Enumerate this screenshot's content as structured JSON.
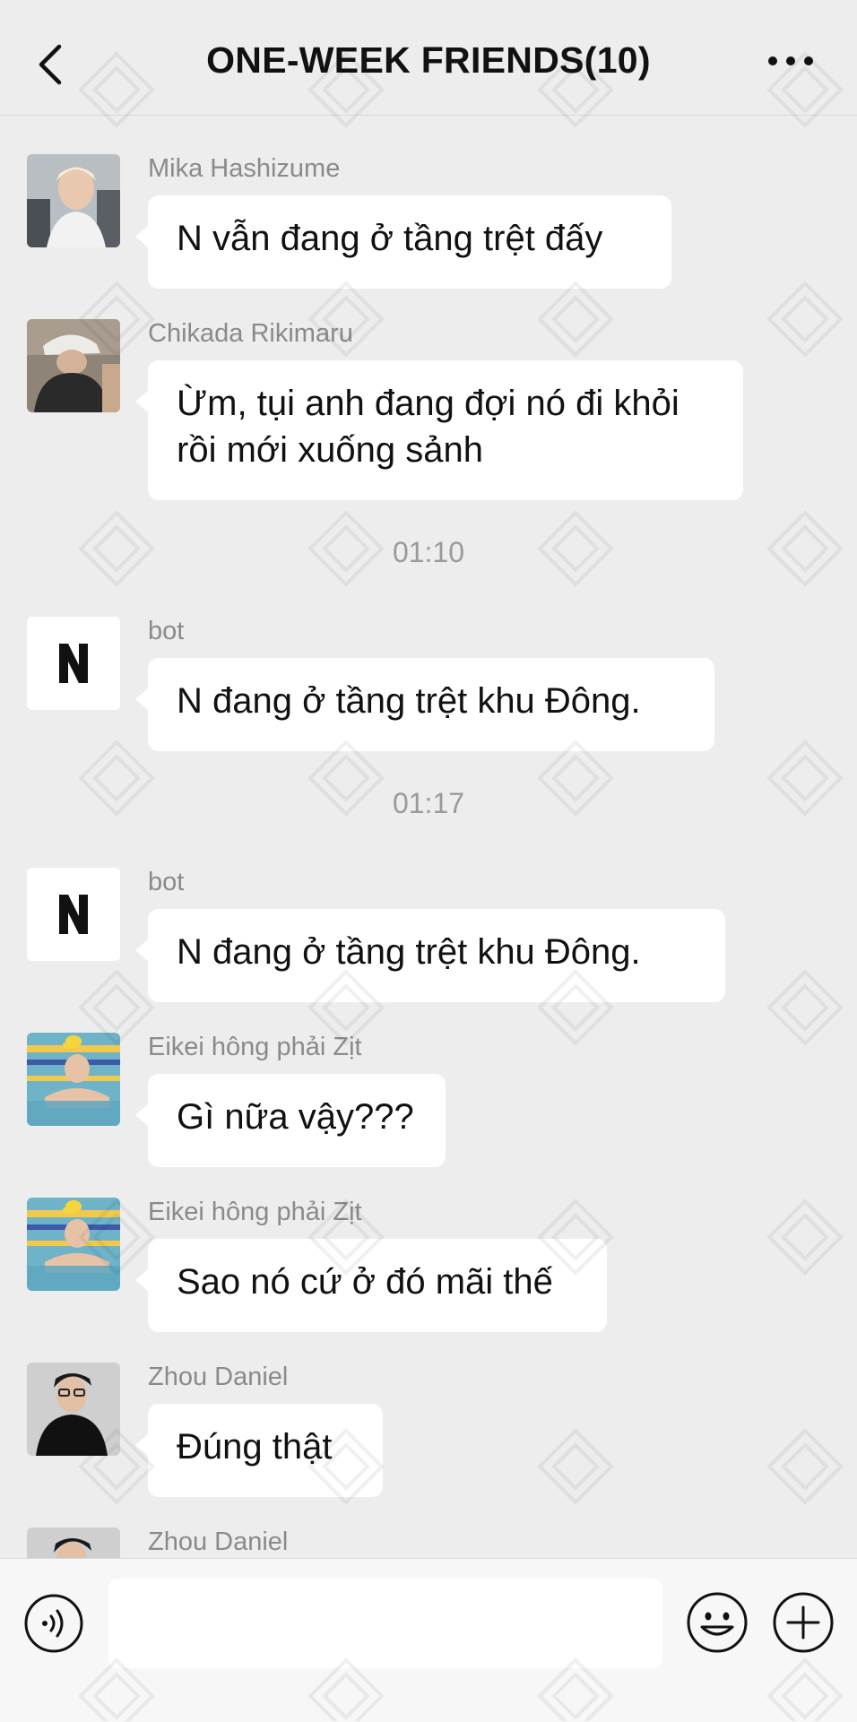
{
  "header": {
    "title": "ONE-WEEK FRIENDS(10)",
    "back_icon": "chevron-left-icon",
    "more_icon": "ellipsis-icon"
  },
  "messages": [
    {
      "sender": "Mika Hashizume",
      "text": "N vẫn đang ở tầng trệt đấy"
    },
    {
      "sender": "Chikada Rikimaru",
      "text": "Ừm, tụi anh đang đợi nó đi khỏi rồi mới xuống sảnh"
    },
    {
      "time": "01:10"
    },
    {
      "sender": "bot",
      "text": "N đang ở tầng trệt khu Đông."
    },
    {
      "time": "01:17"
    },
    {
      "sender": "bot",
      "text": "N đang ở tầng trệt khu Đông."
    },
    {
      "sender": "Eikei hông phải Zịt",
      "text": "Gì nữa vậy???"
    },
    {
      "sender": "Eikei hông phải Zịt",
      "text": "Sao nó cứ ở đó mãi thế"
    },
    {
      "sender": "Zhou Daniel",
      "text": "Đúng thật"
    },
    {
      "sender": "Zhou Daniel"
    }
  ],
  "input_bar": {
    "voice_icon": "voice-icon",
    "message_value": "",
    "emoji_icon": "smiley-icon",
    "plus_icon": "plus-icon"
  },
  "colors": {
    "background": "#EDEDED",
    "bubble": "#FFFFFF",
    "sender_text": "#8A8A8A",
    "time_text": "#9A9A9A"
  }
}
